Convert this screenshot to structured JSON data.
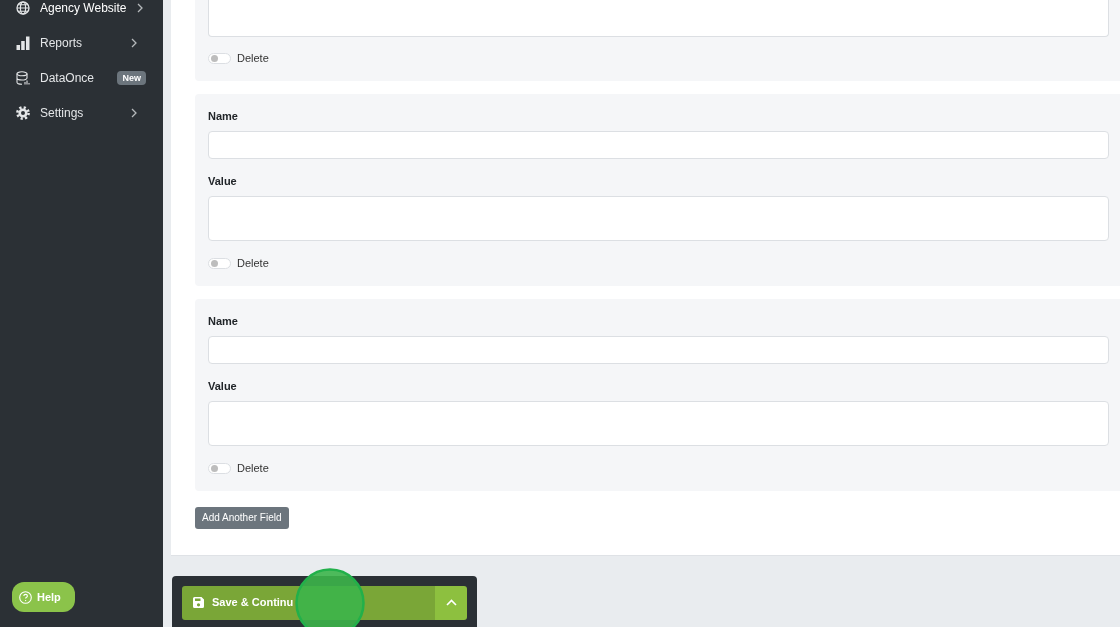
{
  "sidebar": {
    "items": [
      {
        "label": "Agency Website",
        "expandable": true
      },
      {
        "label": "Reports",
        "expandable": true
      },
      {
        "label": "DataOnce",
        "expandable": false,
        "badge": "New"
      },
      {
        "label": "Settings",
        "expandable": true
      }
    ],
    "help_button": {
      "label": "Help"
    }
  },
  "field_groups": [
    {
      "fields": [
        {
          "kind": "textarea"
        }
      ],
      "delete_toggle": {
        "label": "Delete",
        "on": false
      }
    },
    {
      "fields": [
        {
          "label": "Name",
          "kind": "input"
        },
        {
          "label": "Value",
          "kind": "textarea"
        }
      ],
      "delete_toggle": {
        "label": "Delete",
        "on": false
      }
    },
    {
      "fields": [
        {
          "label": "Name",
          "kind": "input"
        },
        {
          "label": "Value",
          "kind": "textarea"
        }
      ],
      "delete_toggle": {
        "label": "Delete",
        "on": false
      }
    }
  ],
  "add_field_button": {
    "label": "Add Another Field"
  },
  "action_bar": {
    "save_button": {
      "label": "Save & Continu"
    }
  }
}
